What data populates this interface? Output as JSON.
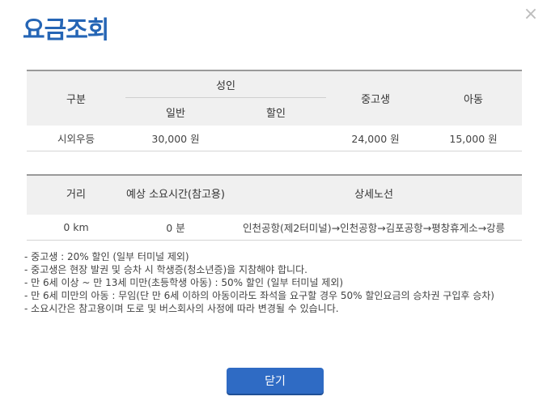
{
  "modal": {
    "title": "요금조회",
    "close_icon": "×",
    "close_button_label": "닫기"
  },
  "fare_table": {
    "headers": {
      "category": "구분",
      "adult": "성인",
      "adult_regular": "일반",
      "adult_discount": "할인",
      "youth": "중고생",
      "child": "아동"
    },
    "rows": [
      {
        "category": "시외우등",
        "adult_regular": "30,000 원",
        "adult_discount": "",
        "youth": "24,000 원",
        "child": "15,000 원"
      }
    ]
  },
  "route_table": {
    "headers": {
      "distance": "거리",
      "duration": "예상 소요시간(참고용)",
      "route": "상세노선"
    },
    "rows": [
      {
        "distance": "0 km",
        "duration": "0 분",
        "route": "인천공항(제2터미널)→인천공항→김포공항→평창휴게소→강릉"
      }
    ]
  },
  "notes": [
    "중고생 : 20% 할인 (일부 터미널 제외)",
    "중고생은 현장 발권 및 승차 시 학생증(청소년증)을 지참해야 합니다.",
    "만 6세 이상 ~ 만 13세 미만(초등학생 아동) : 50% 할인 (일부 터미널 제외)",
    "만 6세 미만의 아동 : 무임(단 만 6세 이하의 아동이라도 좌석을 요구할 경우 50% 할인요금의 승차권 구입후 승차)",
    "소요시간은 참고용이며 도로 및 버스회사의 사정에 따라 변경될 수 있습니다."
  ]
}
